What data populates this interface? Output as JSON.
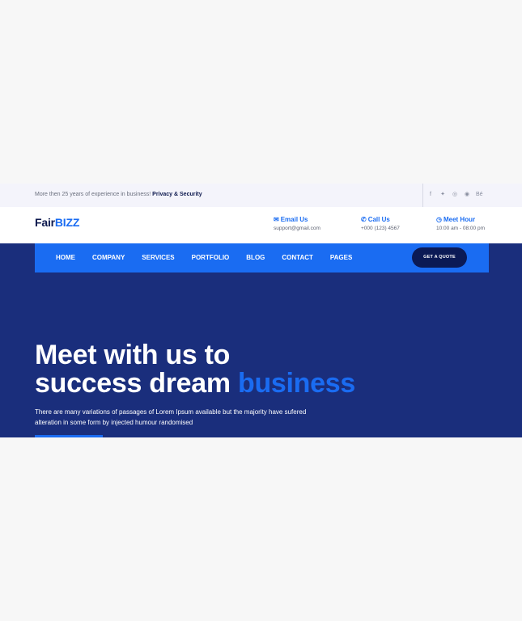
{
  "topbar": {
    "text": "More then 25 years of experience in business!",
    "link": "Privacy & Security",
    "socials": [
      {
        "icon": "facebook-icon",
        "glyph": "f"
      },
      {
        "icon": "twitter-icon",
        "glyph": "✦"
      },
      {
        "icon": "instagram-icon",
        "glyph": "◎"
      },
      {
        "icon": "dribbble-icon",
        "glyph": "◉"
      },
      {
        "icon": "behance-icon",
        "glyph": "Bé"
      }
    ]
  },
  "header": {
    "logo_main": "Fair",
    "logo_accent": "BIZZ",
    "email": {
      "icon": "envelope-icon",
      "title": "Email Us",
      "value": "support@gmail.com"
    },
    "call": {
      "icon": "phone-icon",
      "title": "Call Us",
      "value": "+000 (123) 4567"
    },
    "hours": {
      "icon": "clock-icon",
      "title": "Meet Hour",
      "value": "10:00 am - 08:00 pm"
    }
  },
  "nav": {
    "items": [
      "HOME",
      "COMPANY",
      "SERVICES",
      "PORTFOLIO",
      "BLOG",
      "CONTACT",
      "PAGES"
    ],
    "cta": "GET A QUOTE"
  },
  "hero": {
    "line1": "Meet with us to",
    "line2": "success dream",
    "accent": "business",
    "description": "There are many variations of passages of Lorem Ipsum available but the majority have sufered alteration in some form by injected humour randomised"
  },
  "colors": {
    "accent": "#1a6cf2",
    "hero_bg": "#1a2e7c",
    "navy": "#0e1a4f"
  }
}
